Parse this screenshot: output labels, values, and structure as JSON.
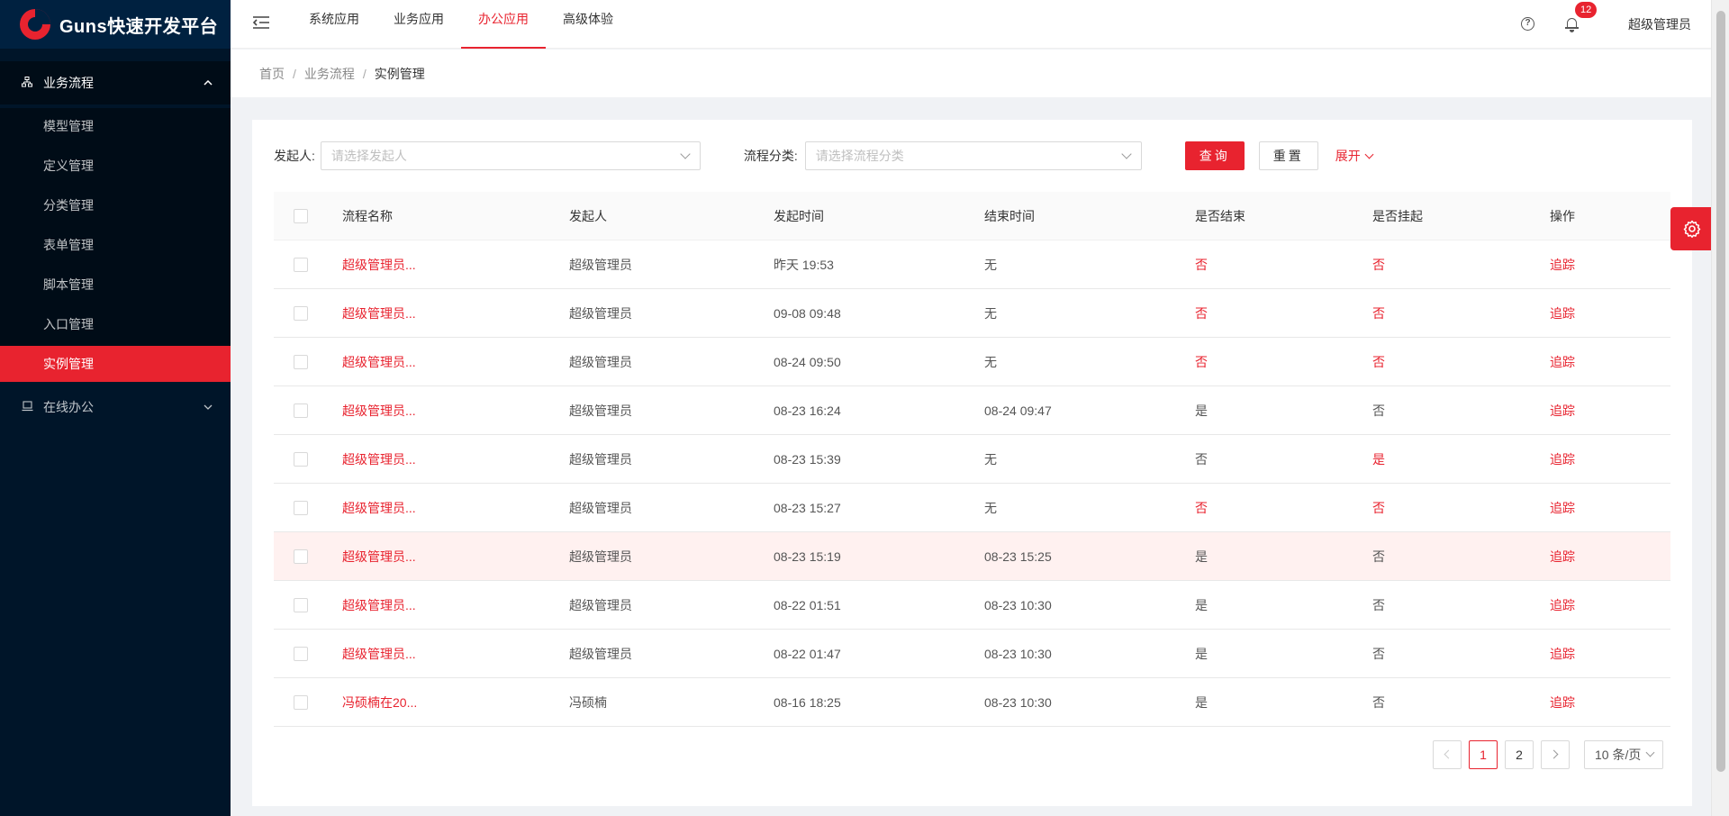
{
  "app": {
    "title": "Guns快速开发平台"
  },
  "sidebar": {
    "groups": [
      {
        "label": "业务流程",
        "icon": "sitemap-icon",
        "expanded": true,
        "items": [
          {
            "label": "模型管理"
          },
          {
            "label": "定义管理"
          },
          {
            "label": "分类管理"
          },
          {
            "label": "表单管理"
          },
          {
            "label": "脚本管理"
          },
          {
            "label": "入口管理"
          },
          {
            "label": "实例管理",
            "active": true
          }
        ]
      },
      {
        "label": "在线办公",
        "icon": "laptop-icon",
        "expanded": false
      }
    ]
  },
  "header": {
    "tabs": [
      {
        "label": "系统应用"
      },
      {
        "label": "业务应用"
      },
      {
        "label": "办公应用",
        "active": true
      },
      {
        "label": "高级体验"
      }
    ],
    "notification_count": "12",
    "user": "超级管理员"
  },
  "breadcrumb": [
    "首页",
    "业务流程",
    "实例管理"
  ],
  "filters": {
    "starter_label": "发起人:",
    "starter_placeholder": "请选择发起人",
    "category_label": "流程分类:",
    "category_placeholder": "请选择流程分类",
    "search_label": "查询",
    "reset_label": "重置",
    "expand_label": "展开"
  },
  "table": {
    "columns": [
      "流程名称",
      "发起人",
      "发起时间",
      "结束时间",
      "是否结束",
      "是否挂起",
      "操作"
    ],
    "rows": [
      {
        "name": "超级管理员...",
        "starter": "超级管理员",
        "start": "昨天 19:53",
        "end": "无",
        "done": "否",
        "suspended": "否",
        "op": "追踪"
      },
      {
        "name": "超级管理员...",
        "starter": "超级管理员",
        "start": "09-08 09:48",
        "end": "无",
        "done": "否",
        "suspended": "否",
        "op": "追踪"
      },
      {
        "name": "超级管理员...",
        "starter": "超级管理员",
        "start": "08-24 09:50",
        "end": "无",
        "done": "否",
        "suspended": "否",
        "op": "追踪"
      },
      {
        "name": "超级管理员...",
        "starter": "超级管理员",
        "start": "08-23 16:24",
        "end": "08-24 09:47",
        "done": "是",
        "suspended": "否",
        "op": "追踪"
      },
      {
        "name": "超级管理员...",
        "starter": "超级管理员",
        "start": "08-23 15:39",
        "end": "无",
        "done": "否",
        "suspended": "是",
        "op": "追踪"
      },
      {
        "name": "超级管理员...",
        "starter": "超级管理员",
        "start": "08-23 15:27",
        "end": "无",
        "done": "否",
        "suspended": "否",
        "op": "追踪"
      },
      {
        "name": "超级管理员...",
        "starter": "超级管理员",
        "start": "08-23 15:19",
        "end": "08-23 15:25",
        "done": "是",
        "suspended": "否",
        "op": "追踪"
      },
      {
        "name": "超级管理员...",
        "starter": "超级管理员",
        "start": "08-22 01:51",
        "end": "08-23 10:30",
        "done": "是",
        "suspended": "否",
        "op": "追踪"
      },
      {
        "name": "超级管理员...",
        "starter": "超级管理员",
        "start": "08-22 01:47",
        "end": "08-23 10:30",
        "done": "是",
        "suspended": "否",
        "op": "追踪"
      },
      {
        "name": "冯硕楠在20...",
        "starter": "冯硕楠",
        "start": "08-16 18:25",
        "end": "08-23 10:30",
        "done": "是",
        "suspended": "否",
        "op": "追踪"
      }
    ]
  },
  "pagination": {
    "pages": [
      "1",
      "2"
    ],
    "current": "1",
    "page_size": "10 条/页"
  },
  "colors": {
    "accent": "#e8232f",
    "sidebar": "#001529",
    "sidebar_dark": "#000c17"
  }
}
